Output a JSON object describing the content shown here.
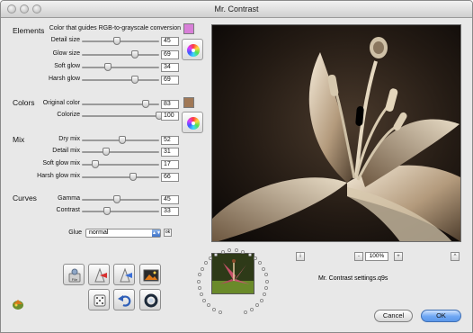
{
  "window": {
    "title": "Mr. Contrast"
  },
  "elements": {
    "heading": "Elements",
    "guide_label": "Color that guides RGB-to-grayscale conversion",
    "guide_color": "#d87fd8",
    "sliders": [
      {
        "label": "Detail size",
        "value": "45",
        "level": 0.45
      },
      {
        "label": "Glow size",
        "value": "69",
        "level": 0.69
      },
      {
        "label": "Soft glow",
        "value": "34",
        "level": 0.34
      },
      {
        "label": "Harsh glow",
        "value": "69",
        "level": 0.69
      }
    ]
  },
  "colors": {
    "heading": "Colors",
    "original_color_swatch": "#a07856",
    "sliders": [
      {
        "label": "Original color",
        "value": "83",
        "level": 0.83
      },
      {
        "label": "Colorize",
        "value": "100",
        "level": 1.0
      }
    ]
  },
  "mix": {
    "heading": "Mix",
    "sliders": [
      {
        "label": "Dry mix",
        "value": "52",
        "level": 0.52
      },
      {
        "label": "Detail mix",
        "value": "31",
        "level": 0.31
      },
      {
        "label": "Soft glow mix",
        "value": "17",
        "level": 0.17
      },
      {
        "label": "Harsh glow mix",
        "value": "66",
        "level": 0.66
      }
    ]
  },
  "curves": {
    "heading": "Curves",
    "sliders": [
      {
        "label": "Gamma",
        "value": "45",
        "level": 0.45
      },
      {
        "label": "Contrast",
        "value": "33",
        "level": 0.33
      }
    ]
  },
  "glue": {
    "label": "Glue",
    "selected": "normal",
    "ok_label": "ok"
  },
  "preview": {
    "info_label": "i",
    "zoom_minus": "-",
    "zoom_value": "100%",
    "zoom_plus": "+",
    "collapse_label": "^",
    "settings_file": "Mr. Contrast settings.q9s"
  },
  "buttons": {
    "cancel": "Cancel",
    "ok": "OK"
  },
  "tools": {
    "file_label": "File"
  }
}
